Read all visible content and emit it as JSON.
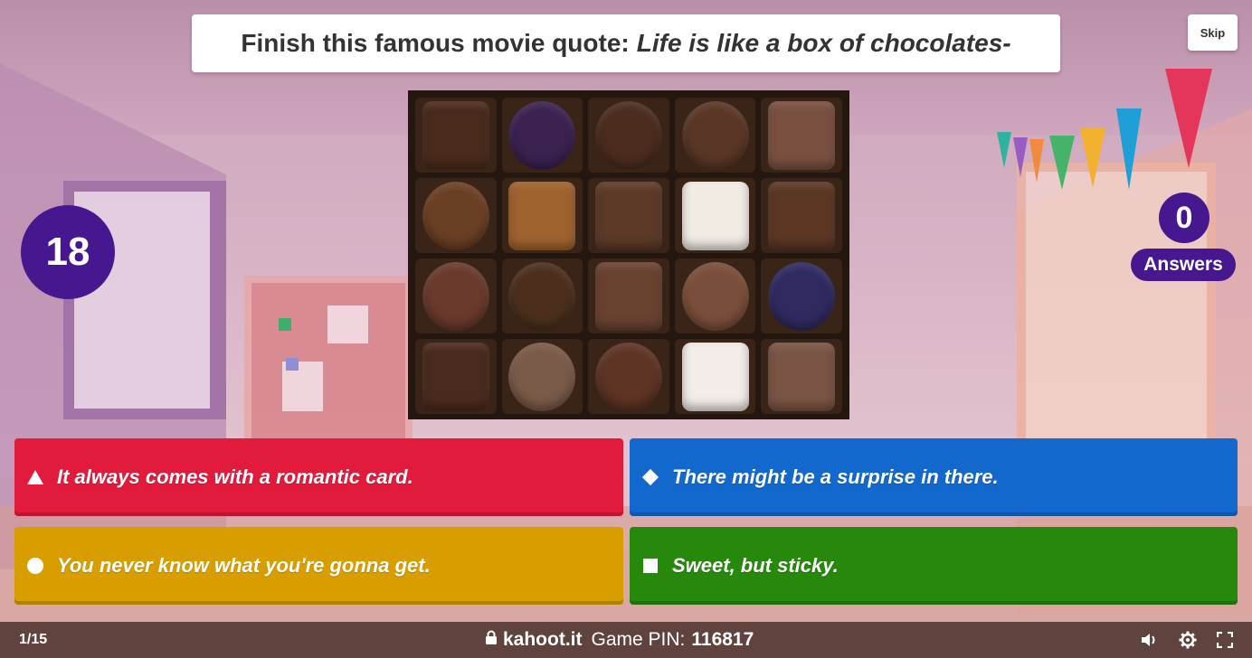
{
  "question": {
    "prefix": "Finish this famous movie quote:",
    "emphasis": "Life is like a box of chocolates-"
  },
  "skip_label": "Skip",
  "timer": {
    "seconds": "18"
  },
  "answers_counter": {
    "count": "0",
    "label": "Answers"
  },
  "image": {
    "subject": "box of assorted chocolates"
  },
  "answer_options": [
    {
      "shape": "triangle-icon",
      "text": "It always comes with a romantic card.",
      "color": "#e21b3c"
    },
    {
      "shape": "diamond-icon",
      "text": "There might be a surprise in there.",
      "color": "#1368ce"
    },
    {
      "shape": "circle-icon",
      "text": "You never know what you're gonna get.",
      "color": "#d89e00"
    },
    {
      "shape": "square-icon",
      "text": "Sweet, but sticky.",
      "color": "#26890c"
    }
  ],
  "footer": {
    "progress": "1/15",
    "join_site": "kahoot.it",
    "pin_label": "Game PIN:",
    "pin_value": "116817",
    "icons": [
      "lock-icon",
      "volume-icon",
      "settings-icon",
      "fullscreen-icon"
    ]
  },
  "colors": {
    "brand_purple": "#46178f"
  }
}
